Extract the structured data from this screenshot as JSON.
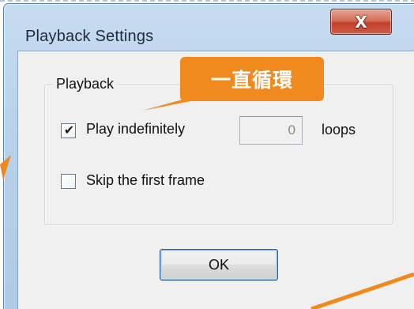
{
  "window": {
    "title": "Playback Settings",
    "close_glyph": "X"
  },
  "group": {
    "legend": "Playback"
  },
  "options": {
    "play_indefinitely": {
      "label": "Play indefinitely",
      "checked": true,
      "check_glyph": "✔"
    },
    "skip_first_frame": {
      "label": "Skip the first frame",
      "checked": false
    }
  },
  "loops": {
    "value": "0",
    "label": "loops"
  },
  "ok_button": {
    "label": "OK"
  },
  "annotation": {
    "callout_text": "一直循環",
    "color": "#f08a1e"
  },
  "colors": {
    "frame": "#b9d1ea",
    "client": "#f0f0f0",
    "close_button": "#c0412c"
  }
}
